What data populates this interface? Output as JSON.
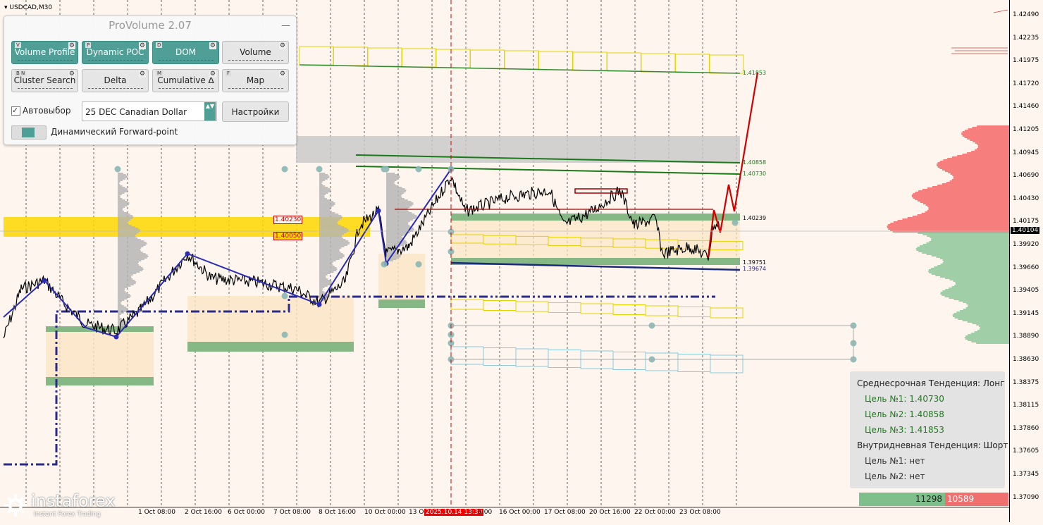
{
  "symbol": "USDCAD,M30",
  "panel": {
    "title": "ProVolume 2.07",
    "minimize": "—",
    "buttons": [
      {
        "label": "Volume Profile",
        "key": "V",
        "state": "on"
      },
      {
        "label": "Dynamic POC",
        "key": "P",
        "state": "on"
      },
      {
        "label": "DOM",
        "key": "D",
        "state": "on"
      },
      {
        "label": "Volume",
        "key": "",
        "state": "off"
      },
      {
        "label": "Cluster Search",
        "key": "B N",
        "state": "off"
      },
      {
        "label": "Delta",
        "key": "",
        "state": "off"
      },
      {
        "label": "Cumulative Δ",
        "key": "M",
        "state": "off"
      },
      {
        "label": "Map",
        "key": "F",
        "state": "off"
      }
    ],
    "gear": "⚙",
    "auto_select_label": "Автовыбор",
    "auto_select_checked": "✓",
    "instrument": "25 DEC Canadian Dollar",
    "spin": "▲▼",
    "settings_label": "Настройки",
    "forward_point_label": "Динамический Forward-point"
  },
  "price_axis": [
    "1.42490",
    "1.42235",
    "1.41975",
    "1.41720",
    "1.41460",
    "1.41205",
    "1.40945",
    "1.40690",
    "1.40430",
    "1.40175",
    "1.39920",
    "1.39660",
    "1.39405",
    "1.39145",
    "1.38890",
    "1.38630",
    "1.38375",
    "1.38115",
    "1.37860",
    "1.37605",
    "1.37345",
    "1.37090"
  ],
  "current_price": "1.40104",
  "time_axis": [
    "1 Oct 08:00",
    "2 Oct 16:00",
    "6 Oct 00:00",
    "7 Oct 08:00",
    "8 Oct 16:00",
    "10 Oct 00:00",
    "13 O",
    "2025.10.14 13:30",
    "6:00",
    "16 Oct 00:00",
    "17 Oct 08:00",
    "20 Oct 16:00",
    "22 Oct 00:00",
    "23 Oct 08:00"
  ],
  "levels": {
    "l1": "1.41853",
    "l2": "1.40858",
    "l3": "1.40730",
    "l4": "1.40239",
    "l5": "1.39751",
    "l6": "1.39674",
    "box1": "1.40230",
    "box2": "1.40050"
  },
  "trend": {
    "midterm": "Среднесрочная Тенденция: Лонг",
    "t1": "Цель №1: 1.40730",
    "t2": "Цель №2: 1.40858",
    "t3": "Цель №3: 1.41853",
    "intraday": "Внутридневная Тенденция: Шорт",
    "i1": "Цель №1: нет",
    "i2": "Цель №2: нет"
  },
  "volume": {
    "buy": "11298",
    "sell": "10589"
  },
  "logo": {
    "brand": "instaforex",
    "tagline": "Instant Forex Trading"
  },
  "colors": {
    "accent": "#4f9f96",
    "bull_zone": "#ffd700",
    "target_line": "#d00000",
    "zigzag": "#2a2ab5"
  }
}
